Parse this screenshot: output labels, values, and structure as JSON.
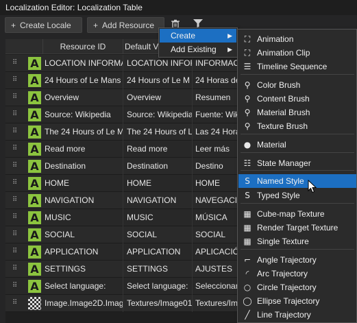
{
  "window": {
    "title": "Localization Editor: Localization Table"
  },
  "toolbar": {
    "create_locale": "Create Locale",
    "add_resource": "Add Resource",
    "plus": "+",
    "delete_icon": "trash-icon",
    "filter_icon": "filter-icon"
  },
  "table": {
    "columns": [
      "Resource ID",
      "Default V",
      ""
    ],
    "rows": [
      {
        "type": "text",
        "id": "LOCATION INFORMAT",
        "default": "LOCATION INFOR",
        "es": "INFORMAC"
      },
      {
        "type": "text",
        "id": "24 Hours of Le Mans",
        "default": "24 Hours of Le M",
        "es": "24 Horas de"
      },
      {
        "type": "text",
        "id": "Overview",
        "default": "Overview",
        "es": "Resumen"
      },
      {
        "type": "text",
        "id": "Source: Wikipedia",
        "default": "Source: Wikipedia",
        "es": "Fuente: Wik"
      },
      {
        "type": "text",
        "id": "The 24 Hours of Le M",
        "default": "The 24 Hours of Le",
        "es": "Las 24 Hora"
      },
      {
        "type": "text",
        "id": "Read more",
        "default": "Read more",
        "es": "Leer más"
      },
      {
        "type": "text",
        "id": "Destination",
        "default": "Destination",
        "es": "Destino"
      },
      {
        "type": "text",
        "id": "HOME",
        "default": "HOME",
        "es": "HOME"
      },
      {
        "type": "text",
        "id": "NAVIGATION",
        "default": "NAVIGATION",
        "es": "NAVEGACIO"
      },
      {
        "type": "text",
        "id": "MUSIC",
        "default": "MUSIC",
        "es": "MÚSICA"
      },
      {
        "type": "text",
        "id": "SOCIAL",
        "default": "SOCIAL",
        "es": "SOCIAL"
      },
      {
        "type": "text",
        "id": "APPLICATION",
        "default": "APPLICATION",
        "es": "APLICACIÓ"
      },
      {
        "type": "text",
        "id": "SETTINGS",
        "default": "SETTINGS",
        "es": "AJUSTES"
      },
      {
        "type": "text",
        "id": "Select language:",
        "default": "Select language:",
        "es": "Seleccionar"
      },
      {
        "type": "texture",
        "id": "Image.Image2D.Image",
        "default": "Textures/Image01",
        "es": "Textures/Im"
      }
    ],
    "text_icon_glyph": "A"
  },
  "add_resource_menu": {
    "items": [
      {
        "label": "Create",
        "selected": true
      },
      {
        "label": "Add Existing",
        "selected": false
      }
    ]
  },
  "create_submenu": {
    "items": [
      {
        "label": "Animation",
        "icon": "animation-icon"
      },
      {
        "label": "Animation Clip",
        "icon": "animation-clip-icon"
      },
      {
        "label": "Timeline Sequence",
        "icon": "timeline-icon"
      },
      {
        "label": "Color Brush",
        "icon": "color-brush-icon"
      },
      {
        "label": "Content Brush",
        "icon": "content-brush-icon"
      },
      {
        "label": "Material Brush",
        "icon": "material-brush-icon"
      },
      {
        "label": "Texture Brush",
        "icon": "texture-brush-icon"
      },
      {
        "label": "Material",
        "icon": "material-icon"
      },
      {
        "label": "State Manager",
        "icon": "state-manager-icon"
      },
      {
        "label": "Named Style",
        "icon": "named-style-icon",
        "selected": true
      },
      {
        "label": "Typed Style",
        "icon": "typed-style-icon"
      },
      {
        "label": "Cube-map Texture",
        "icon": "cubemap-texture-icon"
      },
      {
        "label": "Render Target Texture",
        "icon": "render-target-icon"
      },
      {
        "label": "Single Texture",
        "icon": "single-texture-icon"
      },
      {
        "label": "Angle Trajectory",
        "icon": "angle-trajectory-icon"
      },
      {
        "label": "Arc Trajectory",
        "icon": "arc-trajectory-icon"
      },
      {
        "label": "Circle Trajectory",
        "icon": "circle-trajectory-icon"
      },
      {
        "label": "Ellipse Trajectory",
        "icon": "ellipse-trajectory-icon"
      },
      {
        "label": "Line Trajectory",
        "icon": "line-trajectory-icon"
      }
    ]
  },
  "colors": {
    "selection": "#1c6fc2",
    "text_resource_icon": "#8cc43f"
  }
}
